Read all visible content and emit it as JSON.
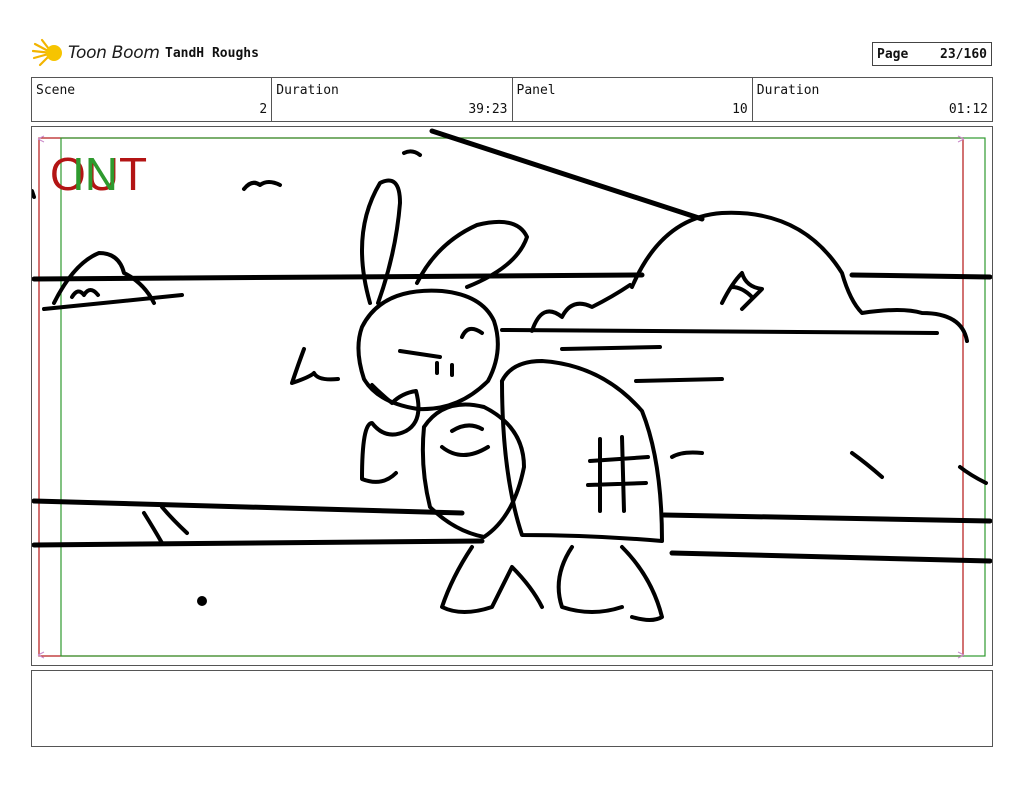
{
  "header": {
    "logo_text": "Toon Boom",
    "project_title": "TandH Roughs",
    "page_label": "Page",
    "page_value": "23/160"
  },
  "info_row": [
    {
      "label": "Scene",
      "value": "2"
    },
    {
      "label": "Duration",
      "value": "39:23"
    },
    {
      "label": "Panel",
      "value": "10"
    },
    {
      "label": "Duration",
      "value": "01:12"
    }
  ],
  "panel": {
    "in_marker": "IN",
    "out_marker": "OUT",
    "frame_colors": {
      "out": "#b31414",
      "in": "#2e9a2e",
      "arrows": "#c98ac9"
    }
  },
  "notes": {
    "text": ""
  }
}
